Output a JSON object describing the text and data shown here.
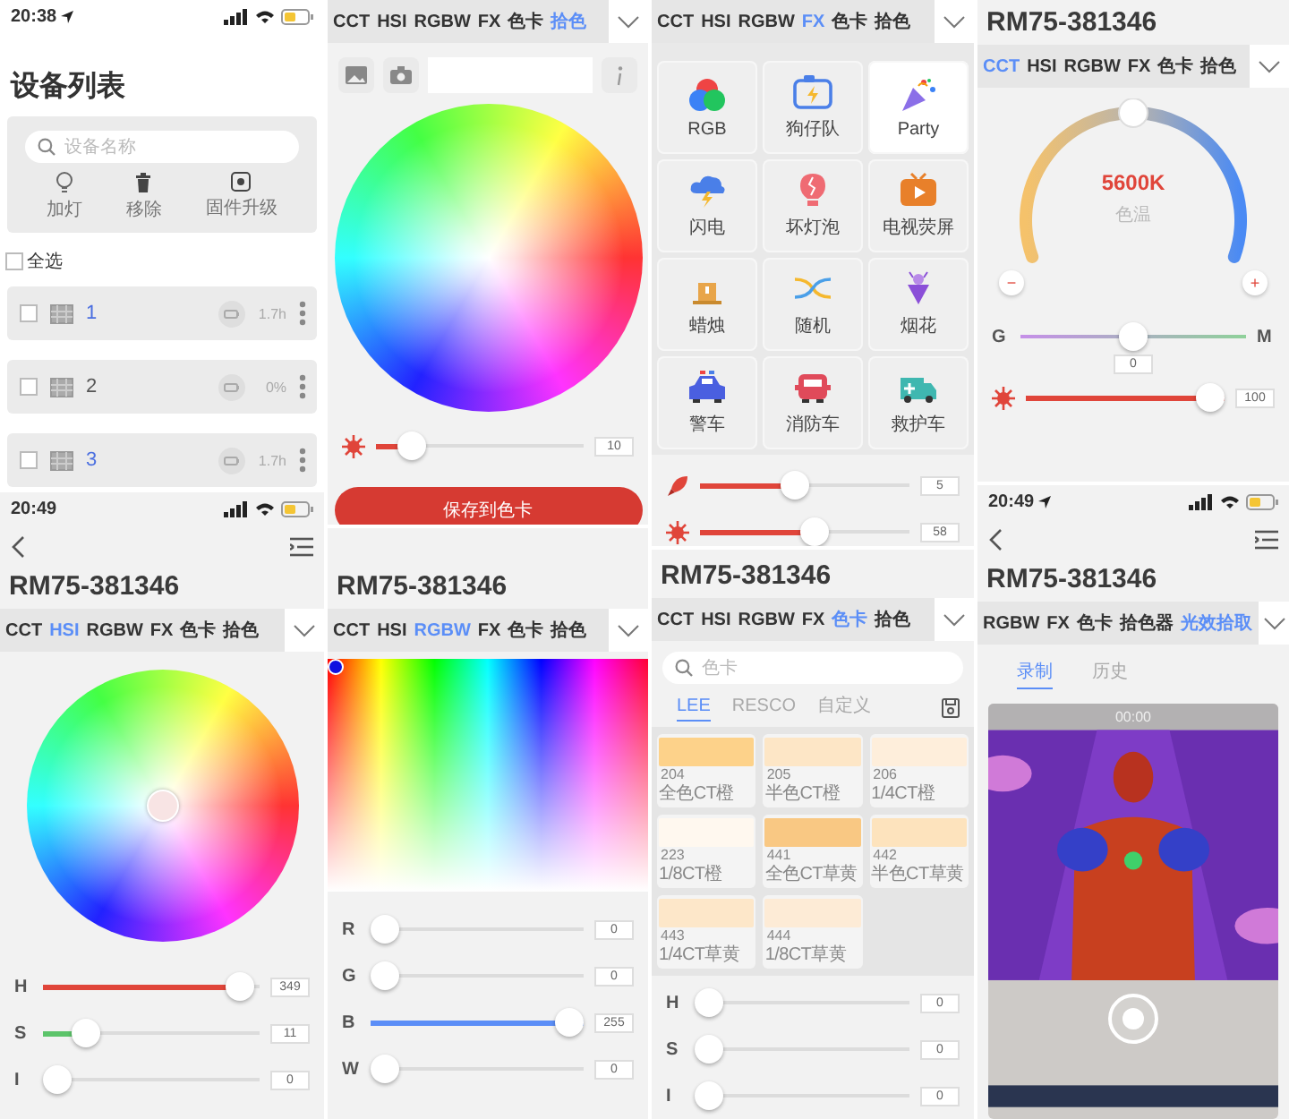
{
  "columns": [
    {
      "panels": [
        {
          "kind": "device_list",
          "time": "20:38",
          "title": "设备列表",
          "search": {
            "placeholder": "设备名称"
          },
          "actions": [
            {
              "label": "加灯"
            },
            {
              "label": "移除"
            },
            {
              "label": "固件升级"
            }
          ],
          "select_all": {
            "label": "全选",
            "checked": false
          },
          "devices": [
            {
              "name": "1",
              "online": true,
              "checked": false,
              "battery": "1.7h"
            },
            {
              "name": "2",
              "online": false,
              "checked": false,
              "battery": "0%"
            },
            {
              "name": "3",
              "online": true,
              "checked": false,
              "battery": "1.7h"
            }
          ]
        },
        {
          "kind": "hsi",
          "time": "20:49",
          "title": "RM75-381346",
          "tabs": [
            {
              "label": "CCT",
              "selected": false
            },
            {
              "label": "HSI",
              "selected": true
            },
            {
              "label": "RGBW",
              "selected": false
            },
            {
              "label": "FX",
              "selected": false
            },
            {
              "label": "色卡",
              "selected": false
            },
            {
              "label": "拾色",
              "selected": false
            }
          ],
          "sliders": [
            {
              "kind": "channel",
              "label": "H",
              "level": 0.97,
              "reading": "349"
            },
            {
              "kind": "channel",
              "label": "S",
              "level": 0.15,
              "reading": "11"
            },
            {
              "kind": "channel",
              "label": "I",
              "level": 0,
              "reading": "0"
            }
          ]
        }
      ]
    },
    {
      "panels": [
        {
          "kind": "picker",
          "tabs": [
            {
              "label": "CCT",
              "selected": false
            },
            {
              "label": "HSI",
              "selected": false
            },
            {
              "label": "RGBW",
              "selected": false
            },
            {
              "label": "FX",
              "selected": false
            },
            {
              "label": "色卡",
              "selected": false
            },
            {
              "label": "拾色",
              "selected": true
            }
          ],
          "sliders": [
            {
              "kind": "brightness",
              "level": 0.12,
              "reading": "10"
            }
          ],
          "save_button": "保存到色卡"
        },
        {
          "kind": "rgbw",
          "title": "RM75-381346",
          "tabs": [
            {
              "label": "CCT",
              "selected": false
            },
            {
              "label": "HSI",
              "selected": false
            },
            {
              "label": "RGBW",
              "selected": true
            },
            {
              "label": "FX",
              "selected": false
            },
            {
              "label": "色卡",
              "selected": false
            },
            {
              "label": "拾色",
              "selected": false
            }
          ],
          "sliders": [
            {
              "kind": "channel",
              "label": "R",
              "level": 0,
              "reading": "0"
            },
            {
              "kind": "channel",
              "label": "G",
              "level": 0,
              "reading": "0"
            },
            {
              "kind": "channel",
              "label": "B",
              "level": 1,
              "reading": "255"
            },
            {
              "kind": "channel",
              "label": "W",
              "level": 0,
              "reading": "0"
            }
          ]
        }
      ]
    },
    {
      "panels": [
        {
          "kind": "fx",
          "tabs": [
            {
              "label": "CCT",
              "selected": false
            },
            {
              "label": "HSI",
              "selected": false
            },
            {
              "label": "RGBW",
              "selected": false
            },
            {
              "label": "FX",
              "selected": true
            },
            {
              "label": "色卡",
              "selected": false
            },
            {
              "label": "拾色",
              "selected": false
            }
          ],
          "effects": [
            {
              "label": "RGB",
              "selected": false
            },
            {
              "label": "狗仔队",
              "selected": false
            },
            {
              "label": "Party",
              "selected": true
            },
            {
              "label": "闪电",
              "selected": false
            },
            {
              "label": "坏灯泡",
              "selected": false
            },
            {
              "label": "电视荧屏",
              "selected": false
            },
            {
              "label": "蜡烛",
              "selected": false
            },
            {
              "label": "随机",
              "selected": false
            },
            {
              "label": "烟花",
              "selected": false
            },
            {
              "label": "警车",
              "selected": false
            },
            {
              "label": "消防车",
              "selected": false
            },
            {
              "label": "救护车",
              "selected": false
            }
          ],
          "sliders": [
            {
              "kind": "speed",
              "level": 0.45,
              "reading": "5"
            },
            {
              "kind": "brightness",
              "level": 0.55,
              "reading": "58"
            }
          ]
        },
        {
          "kind": "swatches",
          "title": "RM75-381346",
          "tabs": [
            {
              "label": "CCT",
              "selected": false
            },
            {
              "label": "HSI",
              "selected": false
            },
            {
              "label": "RGBW",
              "selected": false
            },
            {
              "label": "FX",
              "selected": false
            },
            {
              "label": "色卡",
              "selected": true
            },
            {
              "label": "拾色",
              "selected": false
            }
          ],
          "search": {
            "placeholder": "色卡"
          },
          "libraries": [
            {
              "label": "LEE",
              "selected": true
            },
            {
              "label": "RESCO",
              "selected": false
            },
            {
              "label": "自定义",
              "selected": false
            }
          ],
          "swatches": [
            {
              "code": "204",
              "name": "全色CT橙",
              "color": "#fdd28a"
            },
            {
              "code": "205",
              "name": "半色CT橙",
              "color": "#fde6c6"
            },
            {
              "code": "206",
              "name": "1/4CT橙",
              "color": "#feeedb"
            },
            {
              "code": "223",
              "name": "1/8CT橙",
              "color": "#fff8ef"
            },
            {
              "code": "441",
              "name": "全色CT草黄",
              "color": "#f9c883"
            },
            {
              "code": "442",
              "name": "半色CT草黄",
              "color": "#fde3bd"
            },
            {
              "code": "443",
              "name": "1/4CT草黄",
              "color": "#fde7c9"
            },
            {
              "code": "444",
              "name": "1/8CT草黄",
              "color": "#fdebd6"
            }
          ],
          "sliders": [
            {
              "kind": "channel",
              "label": "H",
              "level": 0,
              "reading": "0"
            },
            {
              "kind": "channel",
              "label": "S",
              "level": 0,
              "reading": "0"
            },
            {
              "kind": "channel",
              "label": "I",
              "level": 0,
              "reading": "0"
            }
          ]
        }
      ]
    },
    {
      "panels": [
        {
          "kind": "cct",
          "title": "RM75-381346",
          "tabs": [
            {
              "label": "CCT",
              "selected": true
            },
            {
              "label": "HSI",
              "selected": false
            },
            {
              "label": "RGBW",
              "selected": false
            },
            {
              "label": "FX",
              "selected": false
            },
            {
              "label": "色卡",
              "selected": false
            },
            {
              "label": "拾色",
              "selected": false
            }
          ],
          "temperature": {
            "level": 0.5,
            "reading": "5600K",
            "label": "色温"
          },
          "minus": "−",
          "plus": "+",
          "sliders": [
            {
              "kind": "tint",
              "label": "G",
              "end_label": "M",
              "level": 0.5,
              "reading": "0"
            },
            {
              "kind": "brightness",
              "level": 1,
              "reading": "100"
            }
          ]
        },
        {
          "kind": "capture",
          "time": "20:49",
          "title": "RM75-381346",
          "tabs": [
            {
              "label": "RGBW",
              "selected": false
            },
            {
              "label": "FX",
              "selected": false
            },
            {
              "label": "色卡",
              "selected": false
            },
            {
              "label": "拾色器",
              "selected": false
            },
            {
              "label": "光效拾取",
              "selected": true
            }
          ],
          "modes": [
            {
              "label": "录制",
              "selected": true
            },
            {
              "label": "历史",
              "selected": false
            }
          ],
          "video": {
            "timer": "00:00"
          }
        }
      ]
    }
  ]
}
